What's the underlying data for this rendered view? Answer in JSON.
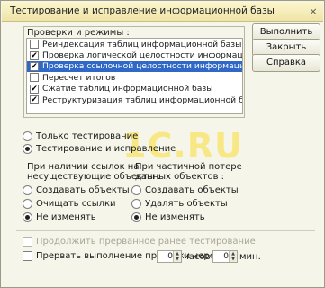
{
  "window": {
    "title": "Тестирование и исправление информационной базы",
    "close_glyph": "×"
  },
  "checks_group": {
    "label": "Проверки и режимы :",
    "items": [
      {
        "label": "Реиндексация таблиц информационной базы",
        "checked": false,
        "selected": false
      },
      {
        "label": "Проверка логической целостности информационной базы",
        "checked": true,
        "selected": false
      },
      {
        "label": "Проверка ссылочной целостности информационной базы",
        "checked": true,
        "selected": true
      },
      {
        "label": "Пересчет итогов",
        "checked": false,
        "selected": false
      },
      {
        "label": "Сжатие таблиц информационной базы",
        "checked": true,
        "selected": false
      },
      {
        "label": "Реструктуризация таблиц информационной базы",
        "checked": true,
        "selected": false
      }
    ]
  },
  "buttons": {
    "run": "Выполнить",
    "close": "Закрыть",
    "help": "Справка"
  },
  "mode": {
    "test_only": "Только тестирование",
    "test_and_fix": "Тестирование и исправление",
    "selected": "test_and_fix"
  },
  "broken_refs": {
    "heading_line1": "При наличии ссылок на",
    "heading_line2": "несуществующие объекты :",
    "options": [
      "Создавать объекты",
      "Очищать ссылки",
      "Не изменять"
    ],
    "selected_index": 2
  },
  "partial_loss": {
    "heading_line1": "При частичной потере",
    "heading_line2": "данных объектов :",
    "options": [
      "Создавать объекты",
      "Удалять объекты",
      "Не изменять"
    ],
    "selected_index": 2
  },
  "resume": {
    "label": "Продолжить прерванное ранее тестирование",
    "checked": false,
    "enabled": false
  },
  "interrupt": {
    "label": "Прервать выполнение проверки через",
    "hours_value": "0",
    "hours_unit": "часов",
    "minutes_value": "0",
    "minutes_unit": "мин."
  },
  "watermark": {
    "text": "1C.RU"
  },
  "colors": {
    "selection": "#3068c8",
    "titlebar": "#efe4a7",
    "window_bg": "#f6f5ea"
  }
}
